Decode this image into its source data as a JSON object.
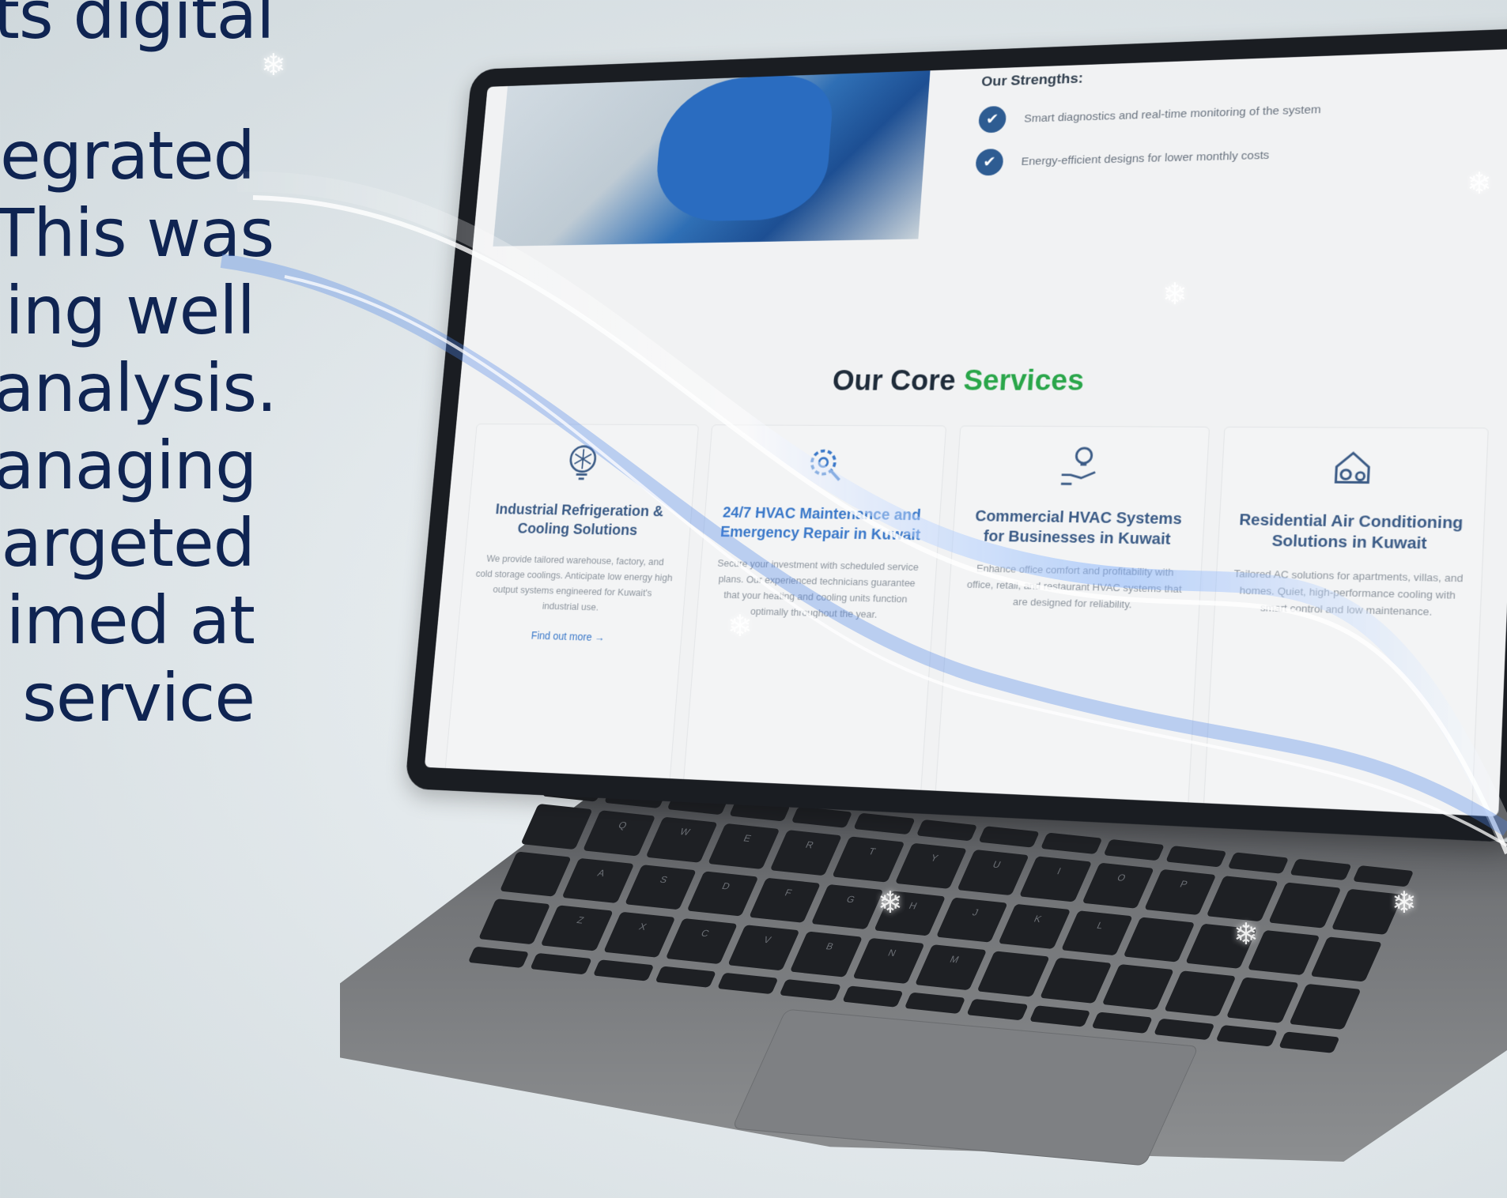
{
  "hero_copy": {
    "lines": [
      "ts digital",
      "",
      "egrated",
      "This was",
      "ing well",
      "analysis.",
      "anaging",
      "argeted",
      "imed at",
      "service"
    ]
  },
  "screen": {
    "strengths": {
      "title": "Our Strengths:",
      "items": [
        "Smart diagnostics and real-time monitoring of the system",
        "Energy-efficient designs for lower monthly costs"
      ]
    },
    "services_heading": {
      "part1": "Our Core",
      "part2": "Services"
    },
    "cards": [
      {
        "icon": "gear-snowflake-icon",
        "title": "Industrial Refrigeration & Cooling Solutions",
        "desc": "We provide tailored warehouse, factory, and cold storage coolings. Anticipate low energy high output systems engineered for Kuwait's industrial use.",
        "link": "Find out more"
      },
      {
        "icon": "gear-wrench-icon",
        "title": "24/7 HVAC Maintenance and Emergency Repair in Kuwait",
        "desc": "Secure your investment with scheduled service plans. Our experienced technicians guarantee that your heating and cooling units function optimally throughout the year.",
        "link": ""
      },
      {
        "icon": "hand-lightbulb-icon",
        "title": "Commercial HVAC Systems for Businesses in Kuwait",
        "desc": "Enhance office comfort and profitability with office, retail, and restaurant HVAC systems that are designed for reliability.",
        "link": ""
      },
      {
        "icon": "house-gear-icon",
        "title": "Residential Air Conditioning Solutions in Kuwait",
        "desc": "Tailored AC solutions for apartments, villas, and homes. Quiet, high-performance cooling with smart control and low maintenance.",
        "link": ""
      }
    ]
  },
  "keyboard": {
    "keys": [
      "",
      "",
      "",
      "",
      "",
      "",
      "",
      "",
      "",
      "",
      "",
      "",
      "",
      "",
      "",
      "Q",
      "W",
      "E",
      "R",
      "T",
      "Y",
      "U",
      "I",
      "O",
      "P",
      "",
      "",
      "",
      "",
      "A",
      "S",
      "D",
      "F",
      "G",
      "H",
      "J",
      "K",
      "L",
      "",
      "",
      "",
      "",
      "",
      "Z",
      "X",
      "C",
      "V",
      "B",
      "N",
      "M",
      "",
      "",
      "",
      "",
      "",
      "",
      "",
      "",
      "",
      "",
      "",
      "",
      "",
      "",
      "",
      "",
      "",
      "",
      "",
      ""
    ]
  },
  "colors": {
    "navy_text": "#0f2452",
    "accent_green": "#2aa64a",
    "accent_blue": "#3a78c9"
  }
}
